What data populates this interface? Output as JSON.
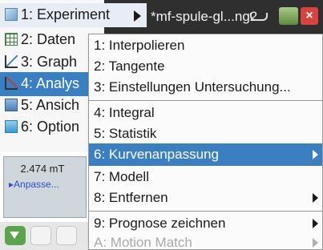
{
  "titlebar": {
    "document": "*mf-spule-gl...ng2",
    "save_glyph": "▿"
  },
  "main_menu": [
    {
      "label": "1: Experiment",
      "icon": "experiment-icon"
    },
    {
      "label": "2: Daten",
      "icon": "data-table-icon"
    },
    {
      "label": "3: Graph",
      "icon": "graph-icon"
    },
    {
      "label": "4: Analys",
      "icon": "analysis-icon"
    },
    {
      "label": "5: Ansich",
      "icon": "view-icon"
    },
    {
      "label": "6: Option",
      "icon": "options-icon"
    }
  ],
  "meter": {
    "value": "2.474 mT",
    "link_label": "Anpasse...",
    "link_marker": "▸"
  },
  "submenu": [
    {
      "label": "1: Interpolieren"
    },
    {
      "label": "2: Tangente"
    },
    {
      "label": "3: Einstellungen Untersuchung..."
    },
    {
      "label": "4: Integral"
    },
    {
      "label": "5: Statistik"
    },
    {
      "label": "6: Kurvenanpassung"
    },
    {
      "label": "7: Modell"
    },
    {
      "label": "8: Entfernen"
    },
    {
      "label": "9: Prognose zeichnen"
    },
    {
      "label": "A: Motion Match"
    }
  ],
  "colors": {
    "highlight": "#3a7fc1",
    "disabled_text": "#a8a8a8",
    "topbar": "#2f2f2f"
  }
}
